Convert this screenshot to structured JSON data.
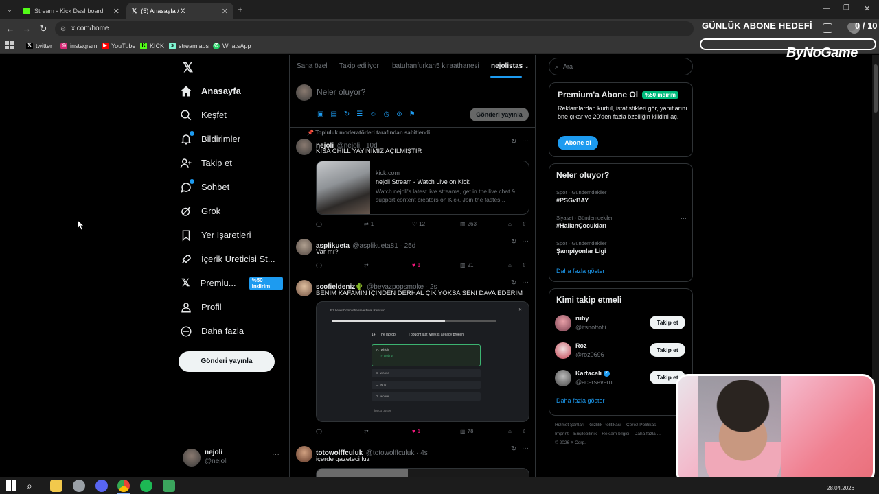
{
  "browser": {
    "tabs": [
      {
        "label": "Stream - Kick Dashboard"
      },
      {
        "label": "(5) Anasayfa / X"
      }
    ],
    "url": "x.com/home",
    "bookmarks": [
      "twitter",
      "instagram",
      "YouTube",
      "KICK",
      "streamlabs",
      "WhatsApp"
    ]
  },
  "overlay": {
    "goal_title": "GÜNLÜK ABONE HEDEFİ",
    "goal_count": "0 / 10",
    "goal_progress": 0,
    "sponsor": "ByNoGame"
  },
  "nav": {
    "items": [
      {
        "label": "Anasayfa",
        "icon": "home-icon"
      },
      {
        "label": "Keşfet",
        "icon": "search-icon"
      },
      {
        "label": "Bildirimler",
        "icon": "bell-icon"
      },
      {
        "label": "Takip et",
        "icon": "person-plus-icon"
      },
      {
        "label": "Sohbet",
        "icon": "chat-icon"
      },
      {
        "label": "Grok",
        "icon": "grok-icon"
      },
      {
        "label": "Yer İşaretleri",
        "icon": "bookmark-icon"
      },
      {
        "label": "İçerik Üreticisi St...",
        "icon": "rocket-icon"
      },
      {
        "label": "Premiu...",
        "icon": "x-logo-icon",
        "badge": "%50 indirim"
      },
      {
        "label": "Profil",
        "icon": "person-icon"
      },
      {
        "label": "Daha fazla",
        "icon": "more-circle-icon"
      }
    ],
    "post_button": "Gönderi yayınla",
    "account": {
      "name": "nejoli",
      "handle": "@nejoli"
    }
  },
  "feed": {
    "tabs": [
      "Sana özel",
      "Takip ediliyor",
      "batuhanfurkan5 kıraathanesi",
      "nejolistas"
    ],
    "compose_placeholder": "Neler oluyor?",
    "compose_button": "Gönderi yayınla",
    "tweets": [
      {
        "pinned": "Topluluk moderatörleri tarafından sabitlendi",
        "name": "nejoli",
        "meta": "@nejoli · 10d",
        "text": "KISA CHILL YAYINIMIZ AÇILMIŞTIR",
        "card": {
          "domain": "kick.com",
          "title": "nejoli Stream - Watch Live on Kick",
          "desc": "Watch nejoli's latest live streams, get in the live chat & support content creators on Kick. Join the fastes..."
        },
        "replies": "",
        "reposts": "1",
        "likes": "12",
        "views": "263"
      },
      {
        "name": "asplikueta",
        "meta": "@asplikueta81 · 25d",
        "text": "Var mı?",
        "replies": "",
        "reposts": "",
        "likes": "1",
        "views": "21"
      },
      {
        "name": "scofieldeniz🌵",
        "meta": "@beyazpopsmoke · 2s",
        "text": "BENİM KAFAMIN İÇİNDEN DERHAL ÇIK YOKSA SENİ DAVA EDERİM",
        "image": {
          "header": "B1 Level Comprehensive Final Revision",
          "question_num": "14.",
          "question": "The laptop ______ I bought last week is already broken.",
          "options": [
            "which",
            "whose",
            "who",
            "where"
          ],
          "correct_note": "Doğru!",
          "hint": "İpucu göster"
        },
        "replies": "",
        "reposts": "",
        "likes": "1",
        "views": "78"
      },
      {
        "name": "totowolffculuk",
        "meta": "@totowolffculuk · 4s",
        "text": "içerde gazeteci kız"
      }
    ]
  },
  "right": {
    "search_placeholder": "Ara",
    "premium": {
      "title": "Premium'a Abone Ol",
      "badge": "%50 indirim",
      "desc": "Reklamlardan kurtul, istatistikleri gör, yanıtlarını öne çıkar ve 20'den fazla özelliğin kilidini aç.",
      "button": "Abone ol"
    },
    "trends": {
      "title": "Neler oluyor?",
      "items": [
        {
          "cat": "Spor · Gündemdekiler",
          "name": "#PSGvBAY"
        },
        {
          "cat": "Siyaset · Gündemdekiler",
          "name": "#HalkınÇocukları"
        },
        {
          "cat": "Spor · Gündemdekiler",
          "name": "Şampiyonlar Ligi"
        }
      ],
      "more": "Daha fazla göster"
    },
    "who_to_follow": {
      "title": "Kimi takip etmeli",
      "items": [
        {
          "name": "ruby",
          "handle": "@itsnottotii",
          "button": "Takip et"
        },
        {
          "name": "Roz",
          "handle": "@roz0696",
          "button": "Takip et"
        },
        {
          "name": "Kartacalı",
          "handle": "@acersevern",
          "button": "Takip et"
        }
      ],
      "more": "Daha fazla göster"
    },
    "footer": [
      "Hizmet Şartları",
      "Gizlilik Politikası",
      "Çerez Politikası",
      "Imprint",
      "Erişilebilirlik",
      "Reklam bilgisi",
      "Daha fazla ...",
      "© 2026 X Corp."
    ]
  },
  "taskbar": {
    "date": "28.04.2026"
  }
}
